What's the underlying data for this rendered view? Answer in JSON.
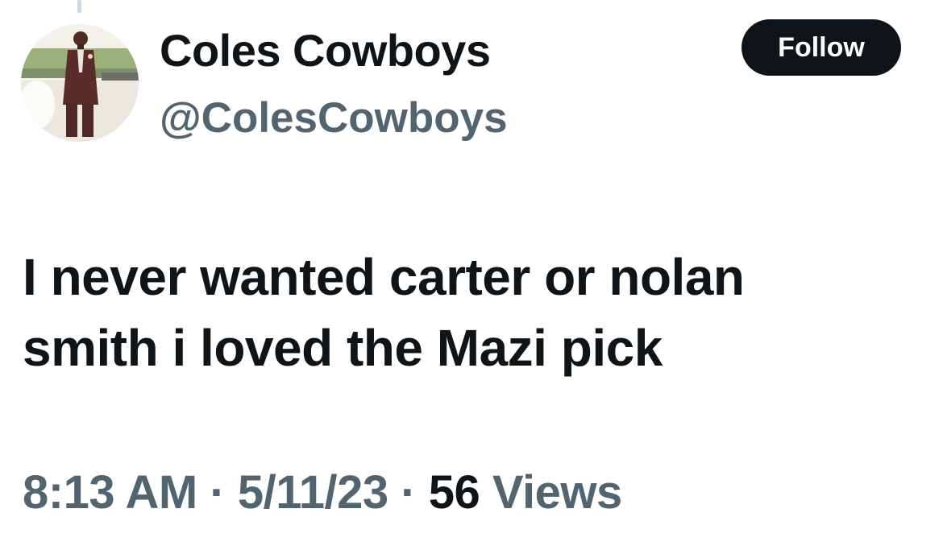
{
  "author": {
    "display_name": "Coles Cowboys",
    "handle": "@ColesCowboys",
    "avatar_icon": "profile-photo"
  },
  "follow_button": {
    "label": "Follow"
  },
  "tweet": {
    "text_line_1": "I never wanted carter or nolan",
    "text_line_2": "smith i loved the Mazi pick"
  },
  "meta": {
    "time": "8:13 AM",
    "separator": "·",
    "date": "5/11/23",
    "views_count": "56",
    "views_label": "Views"
  },
  "colors": {
    "primary_text": "#0f1419",
    "secondary_text": "#536471",
    "button_bg": "#0f1419",
    "button_text": "#ffffff"
  }
}
